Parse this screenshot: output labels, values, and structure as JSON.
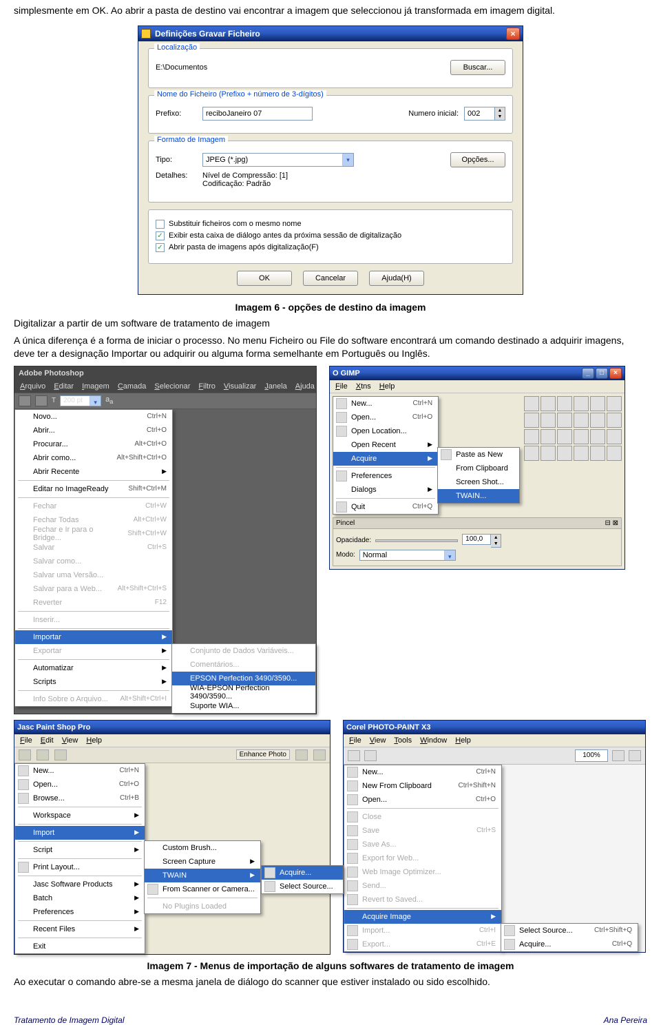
{
  "para1": "simplesmente em OK. Ao abrir a pasta de destino vai encontrar a imagem que seleccionou já transformada em imagem digital.",
  "dialog": {
    "title": "Definições Gravar Ficheiro",
    "group_loc": "Localização",
    "loc_value": "E:\\Documentos",
    "btn_buscar": "Buscar...",
    "group_nome": "Nome do Ficheiro (Prefixo + número de 3-dígitos)",
    "lbl_prefixo": "Prefixo:",
    "prefixo_val": "reciboJaneiro 07",
    "lbl_num": "Numero inicial:",
    "num_val": "002",
    "group_fmt": "Formato de Imagem",
    "lbl_tipo": "Tipo:",
    "tipo_val": "JPEG (*.jpg)",
    "btn_opcoes": "Opções...",
    "lbl_detalhes": "Detalhes:",
    "det1": "Nível de Compressão: [1]",
    "det2": "Codificação: Padrão",
    "chk1": "Substituir ficheiros com o mesmo nome",
    "chk2": "Exibir esta caixa de diálogo antes da próxima sessão de digitalização",
    "chk3": "Abrir pasta de imagens após digitalização(F)",
    "btn_ok": "OK",
    "btn_cancel": "Cancelar",
    "btn_help": "Ajuda(H)"
  },
  "caption6": "Imagem 6 - opções de destino da imagem",
  "para2": "Digitalizar a partir de um software de tratamento de imagem",
  "para3": "A única diferença é a forma de iniciar o processo. No menu Ficheiro ou File do software encontrará um comando destinado a adquirir imagens, deve ter a designação Importar ou adquirir ou alguma forma semelhante em Português ou Inglês.",
  "photoshop": {
    "title": "Adobe Photoshop",
    "menus": [
      "Arquivo",
      "Editar",
      "Imagem",
      "Camada",
      "Selecionar",
      "Filtro",
      "Visualizar",
      "Janela",
      "Ajuda"
    ],
    "toolbar_pt": "200 pt",
    "items": [
      {
        "lbl": "Novo...",
        "sc": "Ctrl+N"
      },
      {
        "lbl": "Abrir...",
        "sc": "Ctrl+O"
      },
      {
        "lbl": "Procurar...",
        "sc": "Alt+Ctrl+O"
      },
      {
        "lbl": "Abrir como...",
        "sc": "Alt+Shift+Ctrl+O"
      },
      {
        "lbl": "Abrir Recente",
        "arr": true
      },
      {
        "sep": true
      },
      {
        "lbl": "Editar no ImageReady",
        "sc": "Shift+Ctrl+M"
      },
      {
        "sep": true
      },
      {
        "lbl": "Fechar",
        "sc": "Ctrl+W",
        "grey": true
      },
      {
        "lbl": "Fechar Todas",
        "sc": "Alt+Ctrl+W",
        "grey": true
      },
      {
        "lbl": "Fechar e Ir para o Bridge...",
        "sc": "Shift+Ctrl+W",
        "grey": true
      },
      {
        "lbl": "Salvar",
        "sc": "Ctrl+S",
        "grey": true
      },
      {
        "lbl": "Salvar como...",
        "grey": true
      },
      {
        "lbl": "Salvar uma Versão...",
        "grey": true
      },
      {
        "lbl": "Salvar para a Web...",
        "sc": "Alt+Shift+Ctrl+S",
        "grey": true
      },
      {
        "lbl": "Reverter",
        "sc": "F12",
        "grey": true
      },
      {
        "sep": true
      },
      {
        "lbl": "Inserir...",
        "grey": true
      },
      {
        "sep": true
      },
      {
        "lbl": "Importar",
        "arr": true,
        "hl": true
      },
      {
        "lbl": "Exportar",
        "arr": true,
        "grey": true
      },
      {
        "sep": true
      },
      {
        "lbl": "Automatizar",
        "arr": true
      },
      {
        "lbl": "Scripts",
        "arr": true
      },
      {
        "sep": true
      },
      {
        "lbl": "Info Sobre o Arquivo...",
        "sc": "Alt+Shift+Ctrl+I",
        "grey": true
      }
    ],
    "sub": [
      {
        "lbl": "Conjunto de Dados Variáveis...",
        "grey": true
      },
      {
        "lbl": "Comentários...",
        "grey": true
      },
      {
        "lbl": "EPSON Perfection 3490/3590...",
        "hl": true
      },
      {
        "lbl": "WIA-EPSON Perfection 3490/3590..."
      },
      {
        "lbl": "Suporte WIA..."
      }
    ]
  },
  "gimp": {
    "title": "O GIMP",
    "menus": [
      "File",
      "Xtns",
      "Help"
    ],
    "items": [
      {
        "lbl": "New...",
        "sc": "Ctrl+N",
        "ico": true
      },
      {
        "lbl": "Open...",
        "sc": "Ctrl+O",
        "ico": true
      },
      {
        "lbl": "Open Location...",
        "ico": true
      },
      {
        "lbl": "Open Recent",
        "arr": true
      },
      {
        "lbl": "Acquire",
        "arr": true,
        "hl": true
      },
      {
        "sep": true
      },
      {
        "lbl": "Preferences",
        "ico": true
      },
      {
        "lbl": "Dialogs",
        "arr": true
      },
      {
        "sep": true
      },
      {
        "lbl": "Quit",
        "sc": "Ctrl+Q",
        "ico": true
      }
    ],
    "sub": [
      {
        "lbl": "Paste as New",
        "ico": true
      },
      {
        "lbl": "From Clipboard"
      },
      {
        "lbl": "Screen Shot..."
      },
      {
        "lbl": "TWAIN...",
        "hl": true
      }
    ],
    "panel_pincel": "Pincel",
    "lbl_opac": "Opacidade:",
    "opac_val": "100,0",
    "lbl_modo": "Modo:",
    "modo_val": "Normal"
  },
  "psp": {
    "title": "Jasc Paint Shop Pro",
    "menus": [
      "File",
      "Edit",
      "View",
      "Help"
    ],
    "enhance": "Enhance Photo",
    "items": [
      {
        "lbl": "New...",
        "sc": "Ctrl+N",
        "ico": true
      },
      {
        "lbl": "Open...",
        "sc": "Ctrl+O",
        "ico": true
      },
      {
        "lbl": "Browse...",
        "sc": "Ctrl+B",
        "ico": true
      },
      {
        "sep": true
      },
      {
        "lbl": "Workspace",
        "arr": true
      },
      {
        "sep": true
      },
      {
        "lbl": "Import",
        "arr": true,
        "hl": true
      },
      {
        "sep": true
      },
      {
        "lbl": "Script",
        "arr": true
      },
      {
        "sep": true
      },
      {
        "lbl": "Print Layout...",
        "ico": true
      },
      {
        "sep": true
      },
      {
        "lbl": "Jasc Software Products",
        "arr": true
      },
      {
        "lbl": "Batch",
        "arr": true
      },
      {
        "lbl": "Preferences",
        "arr": true
      },
      {
        "sep": true
      },
      {
        "lbl": "Recent Files",
        "arr": true
      },
      {
        "sep": true
      },
      {
        "lbl": "Exit"
      }
    ],
    "sub1": [
      {
        "lbl": "Custom Brush..."
      },
      {
        "lbl": "Screen Capture",
        "arr": true
      },
      {
        "lbl": "TWAIN",
        "arr": true,
        "hl": true
      },
      {
        "lbl": "From Scanner or Camera...",
        "ico": true
      },
      {
        "sep": true
      },
      {
        "lbl": "No Plugins Loaded",
        "grey": true
      }
    ],
    "sub2": [
      {
        "lbl": "Acquire...",
        "ico": true,
        "hl": true
      },
      {
        "lbl": "Select Source...",
        "ico": true
      }
    ]
  },
  "corel": {
    "title": "Corel PHOTO-PAINT X3",
    "menus": [
      "File",
      "View",
      "Tools",
      "Window",
      "Help"
    ],
    "pct": "100%",
    "items": [
      {
        "lbl": "New...",
        "sc": "Ctrl+N",
        "ico": true
      },
      {
        "lbl": "New From Clipboard",
        "sc": "Ctrl+Shift+N",
        "ico": true
      },
      {
        "lbl": "Open...",
        "sc": "Ctrl+O",
        "ico": true
      },
      {
        "sep": true
      },
      {
        "lbl": "Close",
        "grey": true,
        "ico": true
      },
      {
        "lbl": "Save",
        "sc": "Ctrl+S",
        "grey": true,
        "ico": true
      },
      {
        "lbl": "Save As...",
        "grey": true,
        "ico": true
      },
      {
        "lbl": "Export for Web...",
        "grey": true,
        "ico": true
      },
      {
        "lbl": "Web Image Optimizer...",
        "grey": true,
        "ico": true
      },
      {
        "lbl": "Send...",
        "grey": true,
        "ico": true
      },
      {
        "lbl": "Revert to Saved...",
        "grey": true,
        "ico": true
      },
      {
        "sep": true
      },
      {
        "lbl": "Acquire Image",
        "arr": true,
        "hl": true
      },
      {
        "lbl": "Import...",
        "sc": "Ctrl+I",
        "grey": true,
        "ico": true
      },
      {
        "lbl": "Export...",
        "sc": "Ctrl+E",
        "grey": true,
        "ico": true
      }
    ],
    "sub": [
      {
        "lbl": "Select Source...",
        "sc": "Ctrl+Shift+Q",
        "ico": true
      },
      {
        "lbl": "Acquire...",
        "sc": "Ctrl+Q",
        "ico": true
      }
    ]
  },
  "caption7": "Imagem 7 - Menus de importação de alguns softwares de tratamento de imagem",
  "para4": "Ao executar o comando abre-se a mesma janela de diálogo do scanner que estiver instalado ou sido escolhido.",
  "footer_left": "Tratamento de Imagem Digital",
  "footer_right": "Ana Pereira"
}
